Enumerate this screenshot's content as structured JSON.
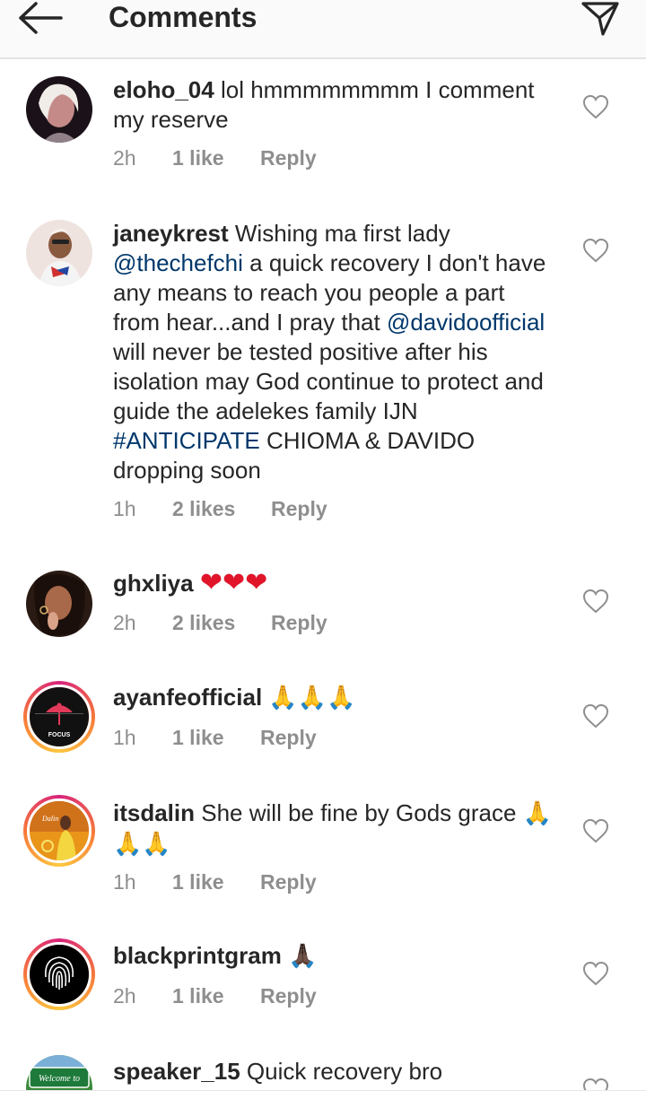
{
  "header": {
    "title": "Comments",
    "back_icon": "arrow-left-icon",
    "share_icon": "send-icon"
  },
  "comments": [
    {
      "username": "eloho_04",
      "parts": [
        "lol hmmmmmmmm I comment my reserve"
      ],
      "time": "2h",
      "likes": "1 like",
      "reply": "Reply"
    },
    {
      "username": "janeykrest",
      "parts": [
        "Wishing ma first lady",
        "@thechefchi",
        "a quick recovery I don't have any means to reach you people a part from hear...and I pray that",
        "@davidoofficial",
        "will never be tested positive after his isolation may God continue to protect and guide the adelekes family IJN",
        "#ANTICIPATE",
        "CHIOMA & DAVIDO dropping soon"
      ],
      "time": "1h",
      "likes": "2 likes",
      "reply": "Reply"
    },
    {
      "username": "ghxliya",
      "emoji": "❤❤❤",
      "time": "2h",
      "likes": "2 likes",
      "reply": "Reply"
    },
    {
      "username": "ayanfeofficial",
      "emoji": "🙏🙏🙏",
      "time": "1h",
      "likes": "1 like",
      "reply": "Reply"
    },
    {
      "username": "itsdalin",
      "parts": [
        "She will be fine by Gods grace"
      ],
      "emoji": "🙏🙏🙏",
      "time": "1h",
      "likes": "1 like",
      "reply": "Reply"
    },
    {
      "username": "blackprintgram",
      "emoji": "🙏🏿",
      "time": "2h",
      "likes": "1 like",
      "reply": "Reply"
    },
    {
      "username": "speaker_15",
      "parts": [
        "Quick recovery bro"
      ]
    }
  ],
  "avatars": {
    "ayanfe_text": "FOCUS",
    "itsdalin_text": "Dalin",
    "speaker_text": "Welcome to"
  },
  "colors": {
    "mention": "#00376b",
    "meta": "#8e8e8e",
    "text": "#262626",
    "heart": "#e0152a"
  }
}
